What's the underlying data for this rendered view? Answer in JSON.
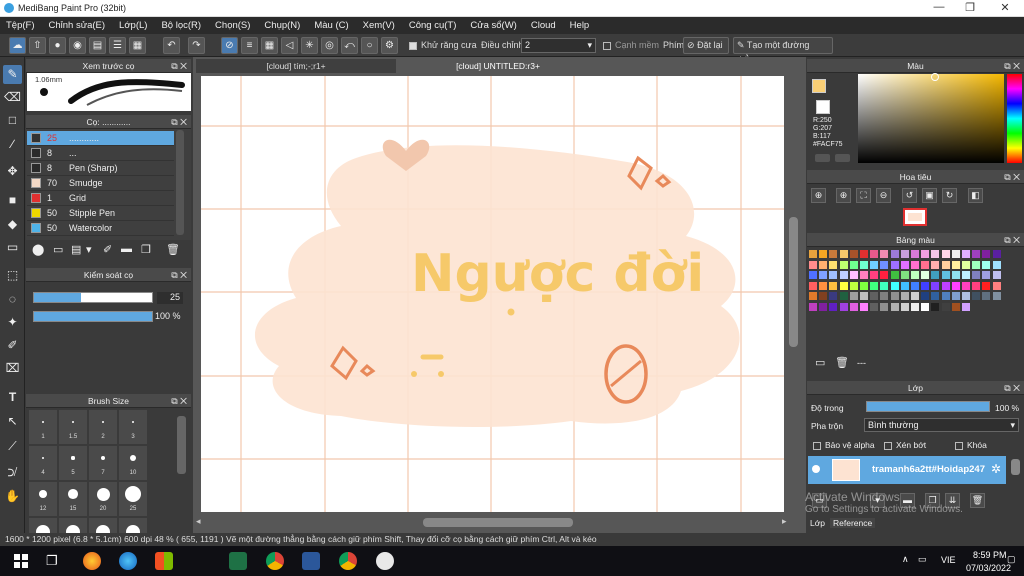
{
  "window": {
    "title": "MediBang Paint Pro (32bit)",
    "controls": [
      "—",
      "❐",
      "✕"
    ]
  },
  "menu": [
    "Tệp(F)",
    "Chỉnh sửa(E)",
    "Lớp(L)",
    "Bộ lọc(R)",
    "Chọn(S)",
    "Chụp(N)",
    "Màu (C)",
    "Xem(V)",
    "Công cụ(T)",
    "Cửa sổ(W)",
    "Cloud",
    "Help"
  ],
  "toolbar": {
    "antialias_label": "Khử răng cưa",
    "correction_label": "Điều chỉnh",
    "correction_value": "2",
    "edge_label": "Cạnh mềm",
    "key_label": "Phím",
    "reset_label": "Đặt lại",
    "line_label": "Tạo một đường thẳng"
  },
  "preview": {
    "title": "Xem trước cọ",
    "size_label": "1.06mm"
  },
  "brush_panel": {
    "title": "Cọ: ............",
    "items": [
      {
        "size": "25",
        "name": "............",
        "color": "#333333",
        "selected": true
      },
      {
        "size": "8",
        "name": "...",
        "color": "#2a2a2a"
      },
      {
        "size": "8",
        "name": "Pen (Sharp)",
        "color": "#2a2a2a"
      },
      {
        "size": "70",
        "name": "Smudge",
        "color": "#f4d9c6"
      },
      {
        "size": "1",
        "name": "Grid",
        "color": "#e03030"
      },
      {
        "size": "50",
        "name": "Stipple Pen",
        "color": "#f0d800"
      },
      {
        "size": "50",
        "name": "Watercolor",
        "color": "#4fb3e8"
      }
    ]
  },
  "brush_control": {
    "title": "Kiểm soát cọ",
    "size_value": "25",
    "opacity_value": "100 %",
    "size_fraction": 0.4,
    "opacity_fraction": 1.0
  },
  "brush_size": {
    "title": "Brush Size",
    "labels": [
      "1",
      "1.5",
      "2",
      "3",
      "4",
      "5",
      "7",
      "10",
      "12",
      "15",
      "20",
      "25"
    ]
  },
  "tabs": [
    "[cloud] tím;-;r1+",
    "[cloud] UNTITLED:r3+"
  ],
  "canvas": {
    "artwork_text": "Ngược đời",
    "artwork_text_color": "#f6c96a",
    "blob_color": "#fde3d2",
    "accent_color": "#e8895a"
  },
  "color_panel": {
    "title": "Màu",
    "r": "R:250",
    "g": "G:207",
    "b": "B:117",
    "hex": "#FACF75",
    "current": "#facf75"
  },
  "navigator": {
    "title": "Hoa tiêu"
  },
  "palette": {
    "title": "Bảng màu",
    "extra": "---"
  },
  "layer_panel": {
    "title": "Lớp",
    "opacity_label": "Độ trong",
    "opacity_value": "100 %",
    "blend_label": "Pha trộn",
    "blend_value": "Bình thường",
    "protect_alpha": "Bảo vệ alpha",
    "clipping": "Xén bớt",
    "lock": "Khóa",
    "layer_name": "tramanh6a2tt#Hoidap247"
  },
  "bottom_tabs": [
    "Lớp",
    "Reference"
  ],
  "watermark": {
    "line1": "Activate Windows",
    "line2": "Go to Settings to activate Windows."
  },
  "status": {
    "text": "1600 * 1200 pixel  (6.8 * 5.1cm)  600 dpi  48 %  ( 655, 1191 )  Vẽ một đường thẳng bằng cách giữ phím Shift, Thay đổi cỡ cọ bằng cách giữ phím Ctrl, Alt và kéo"
  },
  "taskbar": {
    "lang": "VIE",
    "time": "8:59 PM",
    "date": "07/03/2022"
  }
}
